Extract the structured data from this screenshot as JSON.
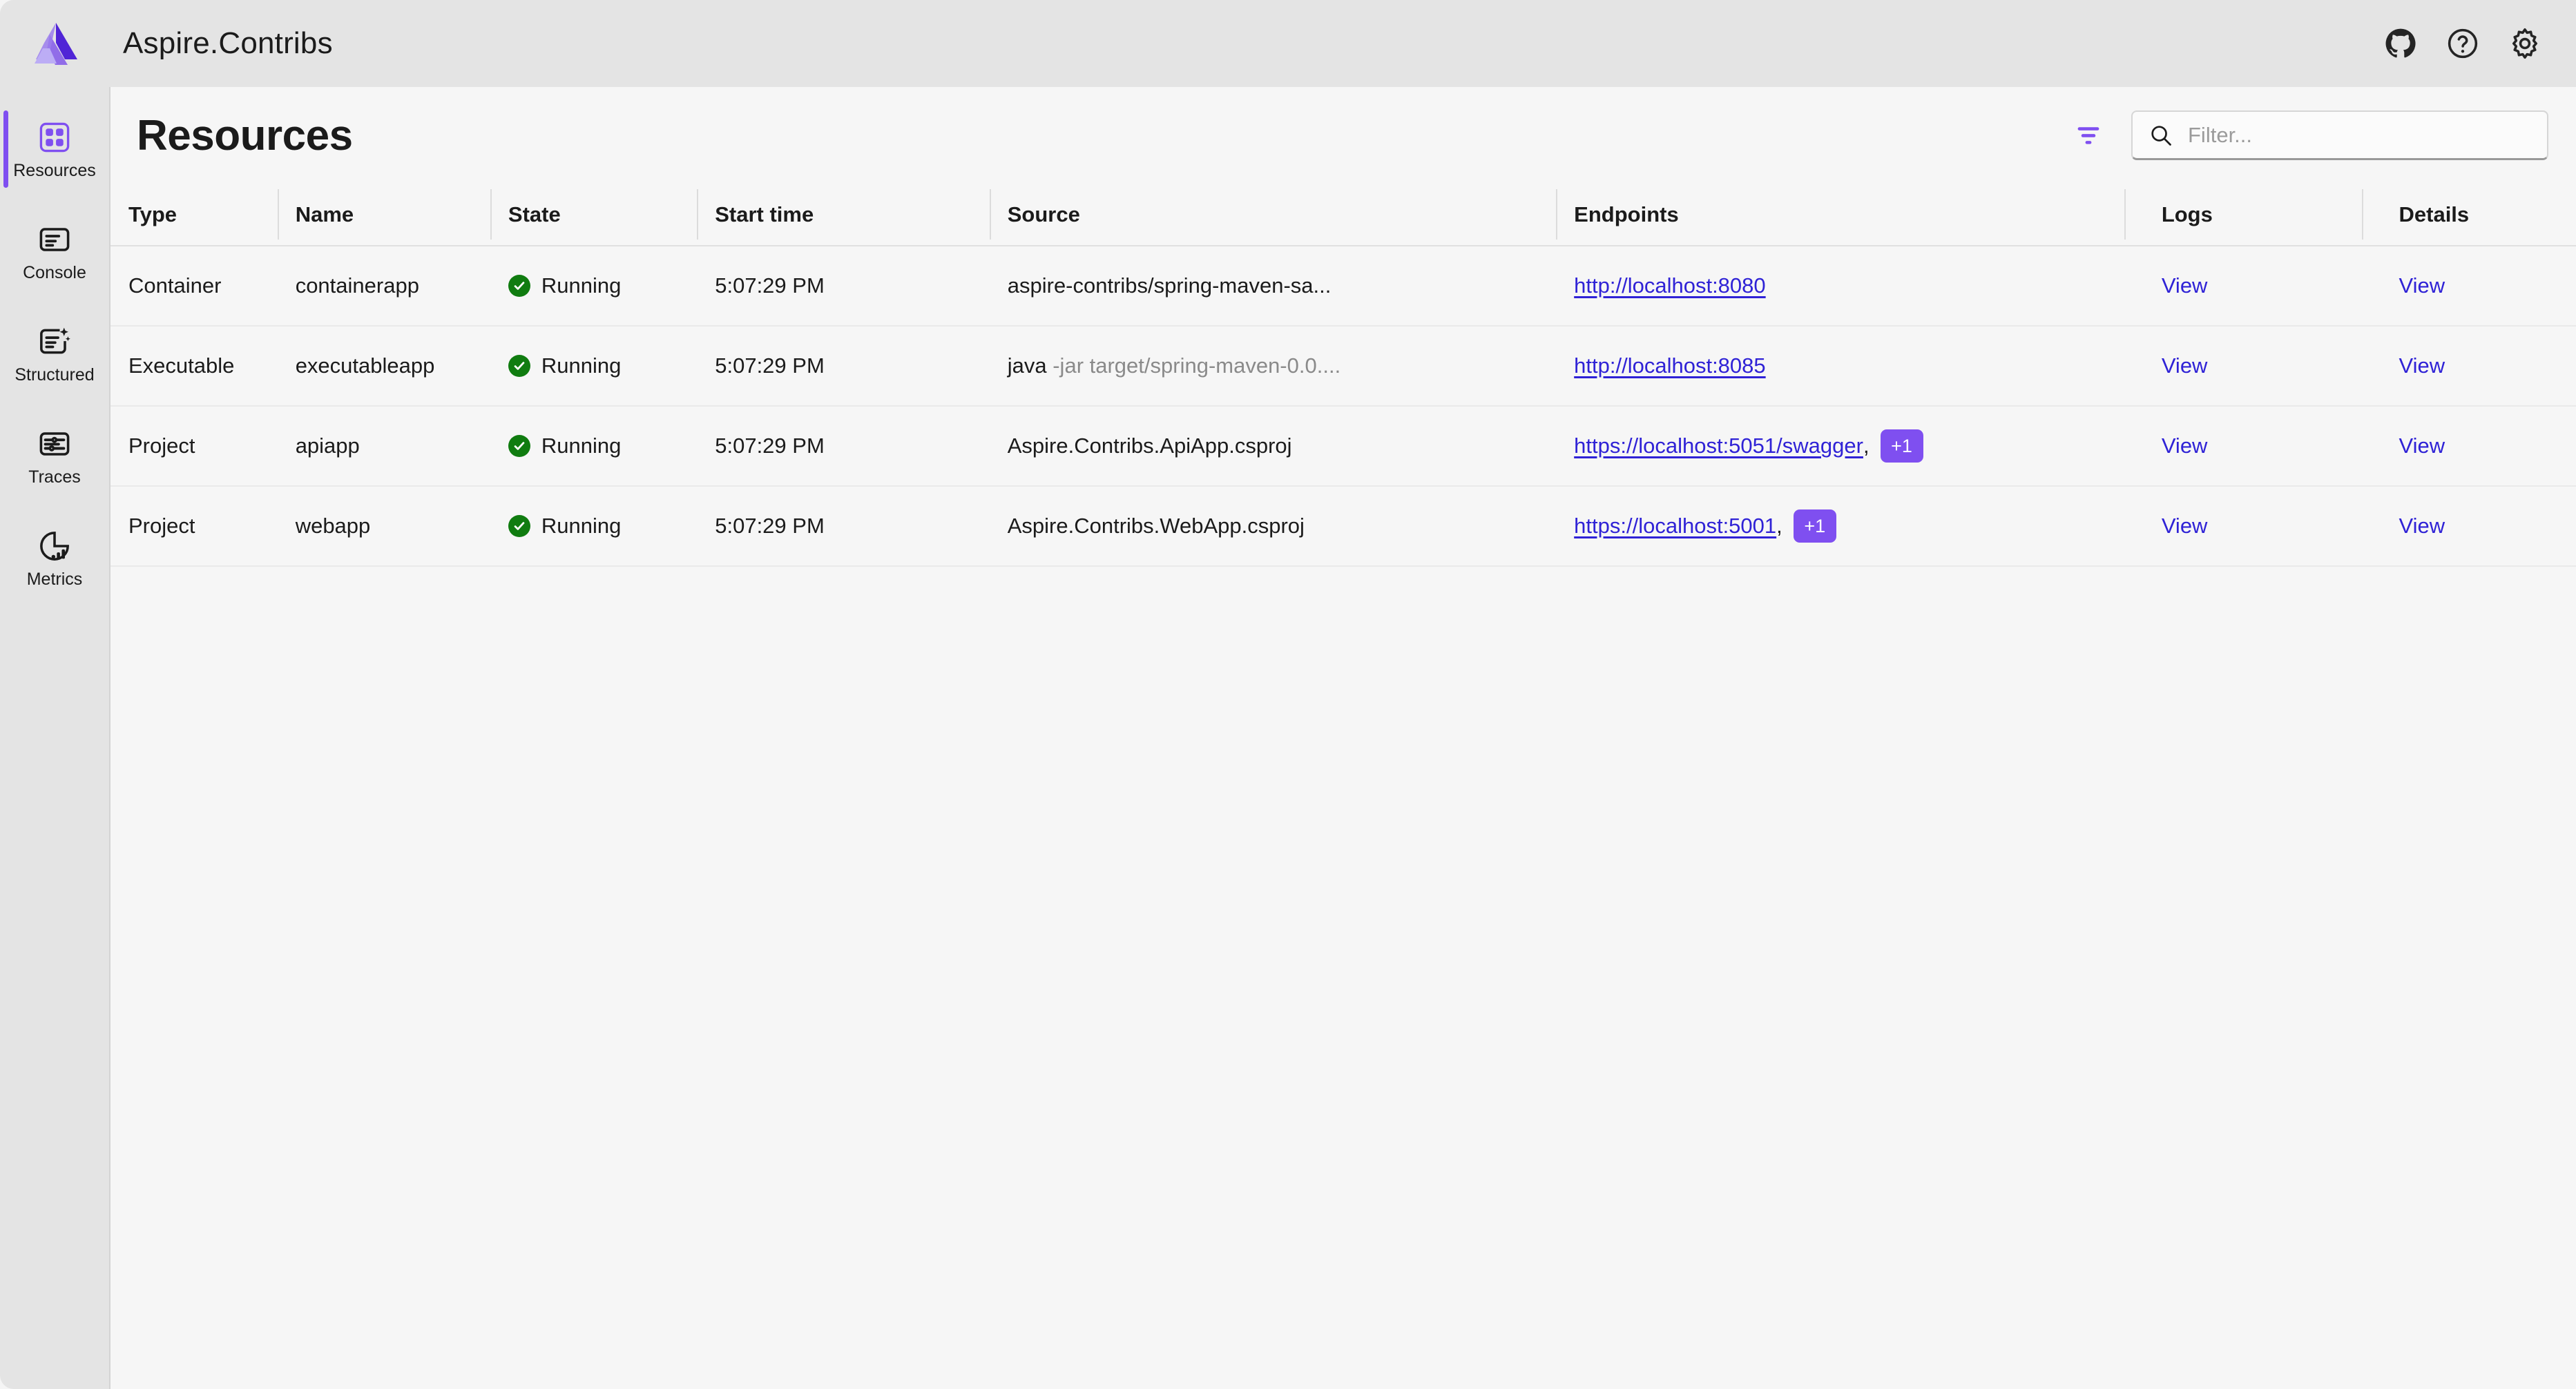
{
  "app": {
    "title": "Aspire.Contribs",
    "logo_icon": "aspire-logo-icon",
    "actions": [
      {
        "name": "github-icon",
        "label": "GitHub"
      },
      {
        "name": "help-icon",
        "label": "Help"
      },
      {
        "name": "gear-icon",
        "label": "Settings"
      }
    ]
  },
  "sidebar": {
    "items": [
      {
        "label": "Resources",
        "icon": "resources-icon",
        "active": true
      },
      {
        "label": "Console",
        "icon": "console-icon",
        "active": false
      },
      {
        "label": "Structured",
        "icon": "structured-icon",
        "active": false
      },
      {
        "label": "Traces",
        "icon": "traces-icon",
        "active": false
      },
      {
        "label": "Metrics",
        "icon": "metrics-icon",
        "active": false
      }
    ]
  },
  "page": {
    "title": "Resources",
    "filter_icon": "filter-icon",
    "search": {
      "icon": "search-icon",
      "placeholder": "Filter...",
      "value": ""
    }
  },
  "table": {
    "columns": [
      "Type",
      "Name",
      "State",
      "Start time",
      "Source",
      "Endpoints",
      "Logs",
      "Details"
    ],
    "rows": [
      {
        "type": "Container",
        "name": "containerapp",
        "state": "Running",
        "state_icon": "checkmark-circle-icon",
        "start_time": "5:07:29 PM",
        "source": "aspire-contribs/spring-maven-sa...",
        "source_dim": "",
        "endpoint": "http://localhost:8080",
        "endpoint_comma": "",
        "endpoint_badge": "",
        "logs": "View",
        "details": "View"
      },
      {
        "type": "Executable",
        "name": "executableapp",
        "state": "Running",
        "state_icon": "checkmark-circle-icon",
        "start_time": "5:07:29 PM",
        "source": "java",
        "source_dim": " -jar target/spring-maven-0.0....",
        "endpoint": "http://localhost:8085",
        "endpoint_comma": "",
        "endpoint_badge": "",
        "logs": "View",
        "details": "View"
      },
      {
        "type": "Project",
        "name": "apiapp",
        "state": "Running",
        "state_icon": "checkmark-circle-icon",
        "start_time": "5:07:29 PM",
        "source": "Aspire.Contribs.ApiApp.csproj",
        "source_dim": "",
        "endpoint": "https://localhost:5051/swagger",
        "endpoint_comma": ",",
        "endpoint_badge": "+1",
        "logs": "View",
        "details": "View"
      },
      {
        "type": "Project",
        "name": "webapp",
        "state": "Running",
        "state_icon": "checkmark-circle-icon",
        "start_time": "5:07:29 PM",
        "source": "Aspire.Contribs.WebApp.csproj",
        "source_dim": "",
        "endpoint": "https://localhost:5001",
        "endpoint_comma": ",",
        "endpoint_badge": "+1",
        "logs": "View",
        "details": "View"
      }
    ]
  },
  "colors": {
    "accent_purple": "#7f4ff0",
    "link_blue": "#2f22d6",
    "status_green": "#107c10",
    "chrome_gray": "#e4e4e4",
    "content_bg": "#f6f6f6"
  }
}
